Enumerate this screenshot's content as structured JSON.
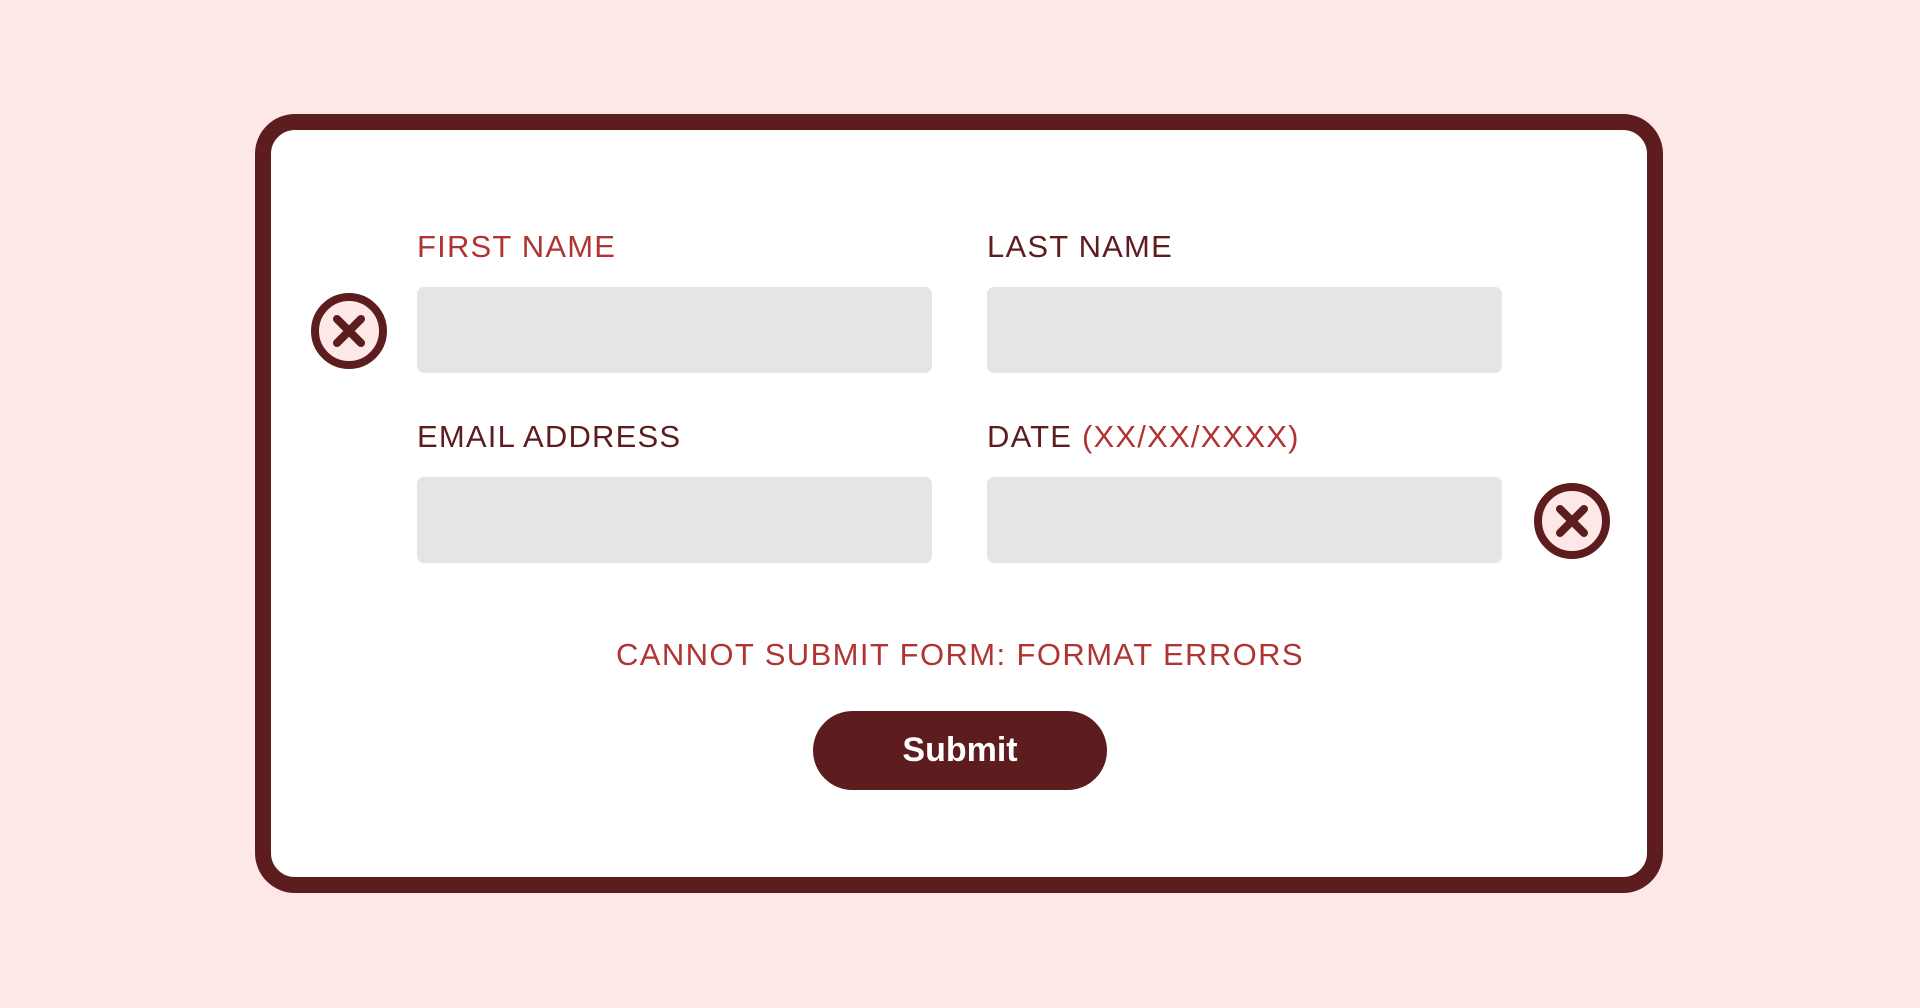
{
  "colors": {
    "background": "#fde8e7",
    "card_border": "#5d1c1e",
    "error_text": "#b03434",
    "field_fill": "#e5e5e5",
    "submit_button": "#5d1c1e"
  },
  "form": {
    "fields": {
      "first_name": {
        "label": "FIRST NAME",
        "value": "",
        "state": "error",
        "icon": "x-circle-icon"
      },
      "last_name": {
        "label": "LAST NAME",
        "value": "",
        "state": "normal"
      },
      "email": {
        "label": "EMAIL ADDRESS",
        "value": "",
        "state": "normal"
      },
      "date": {
        "label": "DATE",
        "format_hint": "(XX/XX/XXXX)",
        "value": "",
        "state": "error",
        "icon": "x-circle-icon"
      }
    },
    "error_message": "CANNOT SUBMIT FORM: FORMAT ERRORS",
    "submit_label": "Submit"
  }
}
